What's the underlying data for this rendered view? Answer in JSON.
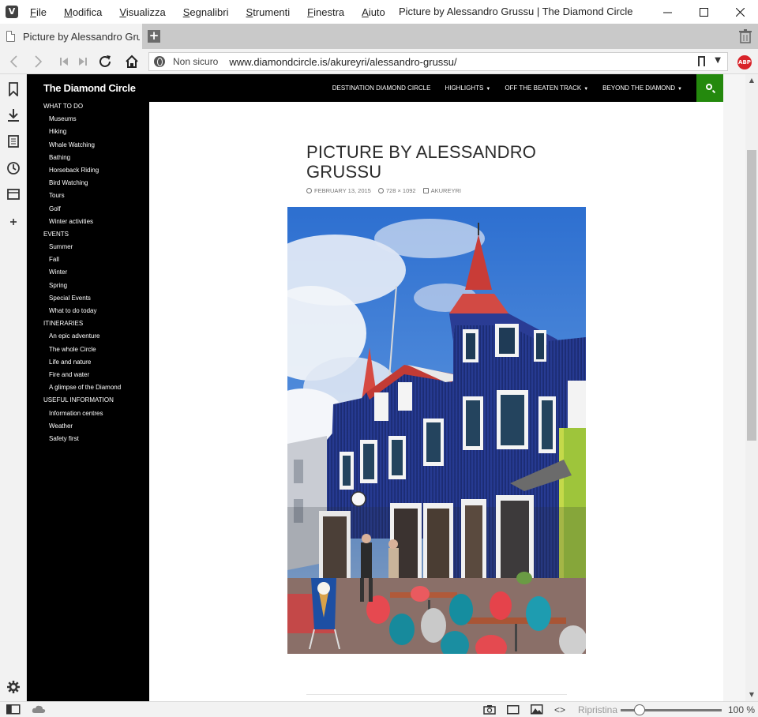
{
  "window": {
    "title": "Picture by Alessandro Grussu | The Diamond Circle",
    "menu": [
      "File",
      "Modifica",
      "Visualizza",
      "Segnalibri",
      "Strumenti",
      "Finestra",
      "Aiuto"
    ]
  },
  "tab": {
    "label": "Picture by Alessandro Grussu"
  },
  "address": {
    "security": "Non sicuro",
    "url": "www.diamondcircle.is/akureyri/alessandro-grussu/"
  },
  "extension": {
    "label": "ABP"
  },
  "status": {
    "reset": "Ripristina",
    "zoom": "100 %"
  },
  "site": {
    "title": "The Diamond Circle",
    "sidebar": [
      {
        "label": "WHAT TO DO",
        "items": [
          "Museums",
          "Hiking",
          "Whale Watching",
          "Bathing",
          "Horseback Riding",
          "Bird Watching",
          "Tours",
          "Golf",
          "Winter activities"
        ]
      },
      {
        "label": "EVENTS",
        "items": [
          "Summer",
          "Fall",
          "Winter",
          "Spring",
          "Special Events",
          "What to do today"
        ]
      },
      {
        "label": "ITINERARIES",
        "items": [
          "An epic adventure",
          "The whole Circle",
          "Life and nature",
          "Fire and water",
          "A glimpse of the Diamond"
        ]
      },
      {
        "label": "USEFUL INFORMATION",
        "items": [
          "Information centres",
          "Weather",
          "Safety first"
        ]
      }
    ],
    "topnav": [
      {
        "label": "DESTINATION DIAMOND CIRCLE",
        "dropdown": false
      },
      {
        "label": "HIGHLIGHTS",
        "dropdown": true
      },
      {
        "label": "OFF THE BEATEN TRACK",
        "dropdown": true
      },
      {
        "label": "BEYOND THE DIAMOND",
        "dropdown": true
      }
    ],
    "accent": "#24890d"
  },
  "entry": {
    "title": "Picture by Alessandro Grussu",
    "date": "February 13, 2015",
    "dimensions": "728 × 1092",
    "category": "Akureyri"
  }
}
